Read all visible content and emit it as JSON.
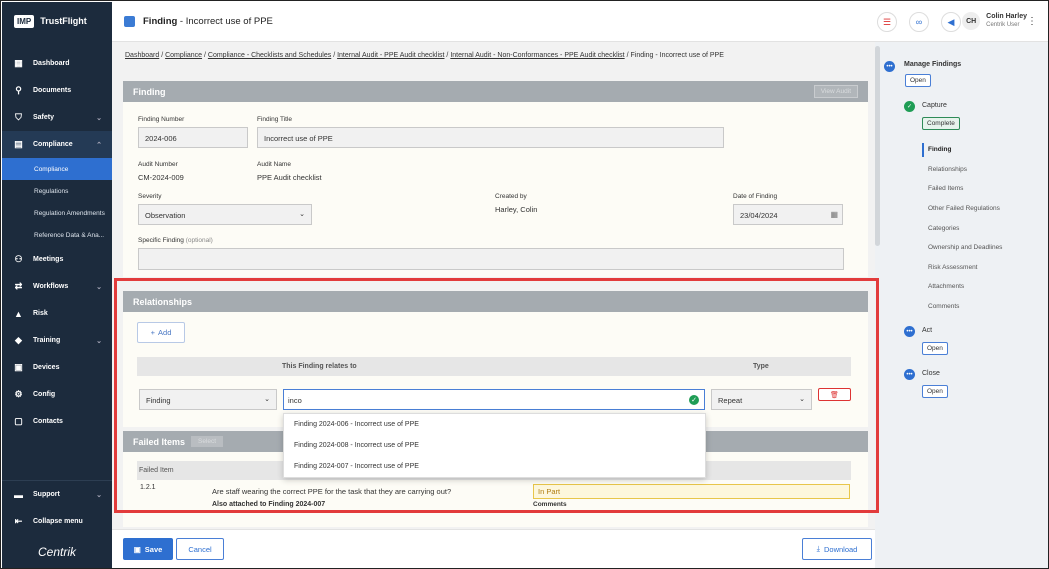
{
  "brand": {
    "logo": "IMP",
    "name": "TrustFlight"
  },
  "nav": {
    "items": [
      {
        "label": "Dashboard",
        "icon": "dashboard-icon"
      },
      {
        "label": "Documents",
        "icon": "paperclip-icon"
      },
      {
        "label": "Safety",
        "icon": "shield-icon"
      },
      {
        "label": "Compliance",
        "icon": "clipboard-icon"
      }
    ],
    "sub": [
      "Compliance",
      "Regulations",
      "Regulation Amendments",
      "Reference Data & Ana..."
    ],
    "items2": [
      {
        "label": "Meetings",
        "icon": "people-icon"
      },
      {
        "label": "Workflows",
        "icon": "workflow-icon"
      },
      {
        "label": "Risk",
        "icon": "warning-icon"
      },
      {
        "label": "Training",
        "icon": "graduation-icon"
      },
      {
        "label": "Devices",
        "icon": "devices-icon"
      },
      {
        "label": "Config",
        "icon": "config-icon"
      },
      {
        "label": "Contacts",
        "icon": "contacts-icon"
      }
    ],
    "support": "Support",
    "collapse": "Collapse menu",
    "footer_logo": "Centrik"
  },
  "header": {
    "title_bold": "Finding",
    "title_rest": " - Incorrect use of PPE",
    "user_initials": "CH",
    "user_name": "Colin Harley",
    "user_role": "Centrik User"
  },
  "breadcrumb": [
    "Dashboard",
    "Compliance",
    "Compliance - Checklists and Schedules",
    "Internal Audit - PPE Audit checklist",
    "Internal Audit - Non-Conformances - PPE Audit checklist",
    "Finding - Incorrect use of PPE"
  ],
  "finding": {
    "head": "Finding",
    "view_audit": "View Audit",
    "number_label": "Finding Number",
    "number": "2024-006",
    "title_label": "Finding Title",
    "title": "Incorrect use of PPE",
    "audit_number_label": "Audit Number",
    "audit_number": "CM-2024-009",
    "audit_name_label": "Audit Name",
    "audit_name": "PPE Audit checklist",
    "severity_label": "Severity",
    "severity": "Observation",
    "created_by_label": "Created by",
    "created_by": "Harley, Colin",
    "date_label": "Date of Finding",
    "date": "23/04/2024",
    "specific_label": "Specific Finding",
    "specific_optional": "(optional)"
  },
  "relationships": {
    "head": "Relationships",
    "add": "Add",
    "col_relates": "This Finding relates to",
    "col_type": "Type",
    "row_kind": "Finding",
    "search_value": "inco",
    "type": "Repeat",
    "options": [
      "Finding 2024-006 - Incorrect use of PPE",
      "Finding 2024-008 - Incorrect use of PPE",
      "Finding 2024-007 - Incorrect use of PPE"
    ]
  },
  "failed": {
    "head": "Failed Items",
    "select": "Select",
    "col": "Failed Item",
    "num": "1.2.1",
    "question": "Are staff wearing the correct PPE for the task that they are carrying out?",
    "attached": "Also attached to Finding 2024-007",
    "status": "In Part",
    "comments": "Comments"
  },
  "footer": {
    "save": "Save",
    "cancel": "Cancel",
    "download": "Download"
  },
  "panel": {
    "manage": "Manage Findings",
    "manage_status": "Open",
    "capture": "Capture",
    "capture_status": "Complete",
    "steps": [
      "Finding",
      "Relationships",
      "Failed Items",
      "Other Failed Regulations",
      "Categories",
      "Ownership and Deadlines",
      "Risk Assessment",
      "Attachments",
      "Comments"
    ],
    "act": "Act",
    "act_status": "Open",
    "close": "Close",
    "close_status": "Open"
  }
}
